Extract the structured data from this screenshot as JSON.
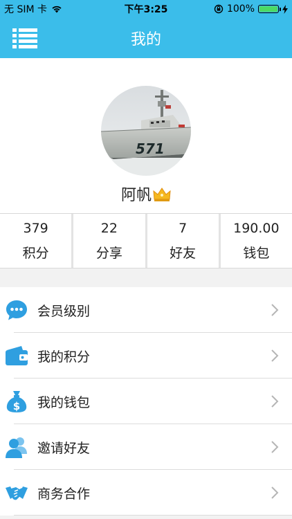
{
  "status_bar": {
    "carrier": "无 SIM 卡",
    "time": "下午3:25",
    "battery": "100%",
    "battery_level": 1.0
  },
  "nav": {
    "title": "我的",
    "menu_icon": "list-menu-icon"
  },
  "profile": {
    "username": "阿帆",
    "avatar_text": "571",
    "badge_icon": "crown-icon"
  },
  "stats": [
    {
      "value": "379",
      "label": "积分"
    },
    {
      "value": "22",
      "label": "分享"
    },
    {
      "value": "7",
      "label": "好友"
    },
    {
      "value": "190.00",
      "label": "钱包"
    }
  ],
  "menu": [
    {
      "label": "会员级别",
      "icon": "chat-bubble-icon"
    },
    {
      "label": "我的积分",
      "icon": "wallet-icon"
    },
    {
      "label": "我的钱包",
      "icon": "money-bag-icon"
    },
    {
      "label": "邀请好友",
      "icon": "users-icon"
    },
    {
      "label": "商务合作",
      "icon": "handshake-icon"
    }
  ],
  "colors": {
    "accent": "#3bbdea",
    "icon_blue": "#2f9fe0",
    "background": "#f2f2f2"
  }
}
